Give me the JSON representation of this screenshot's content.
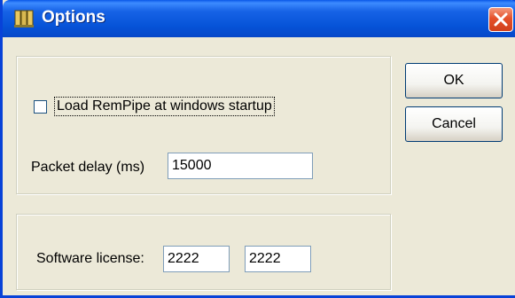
{
  "window": {
    "title": "Options",
    "icon": "remote-pipe-icon",
    "close_icon": "close-icon",
    "titlebar_color": "#0653d8",
    "close_color": "#e5502a"
  },
  "general_group": {
    "load_at_startup": {
      "label": "Load RemPipe at windows startup",
      "checked": false
    },
    "packet_delay": {
      "label": "Packet delay (ms)",
      "value": "15000"
    }
  },
  "license_group": {
    "label": "Software license:",
    "part1": "2222",
    "part2": "2222"
  },
  "buttons": {
    "ok_label": "OK",
    "cancel_label": "Cancel"
  }
}
